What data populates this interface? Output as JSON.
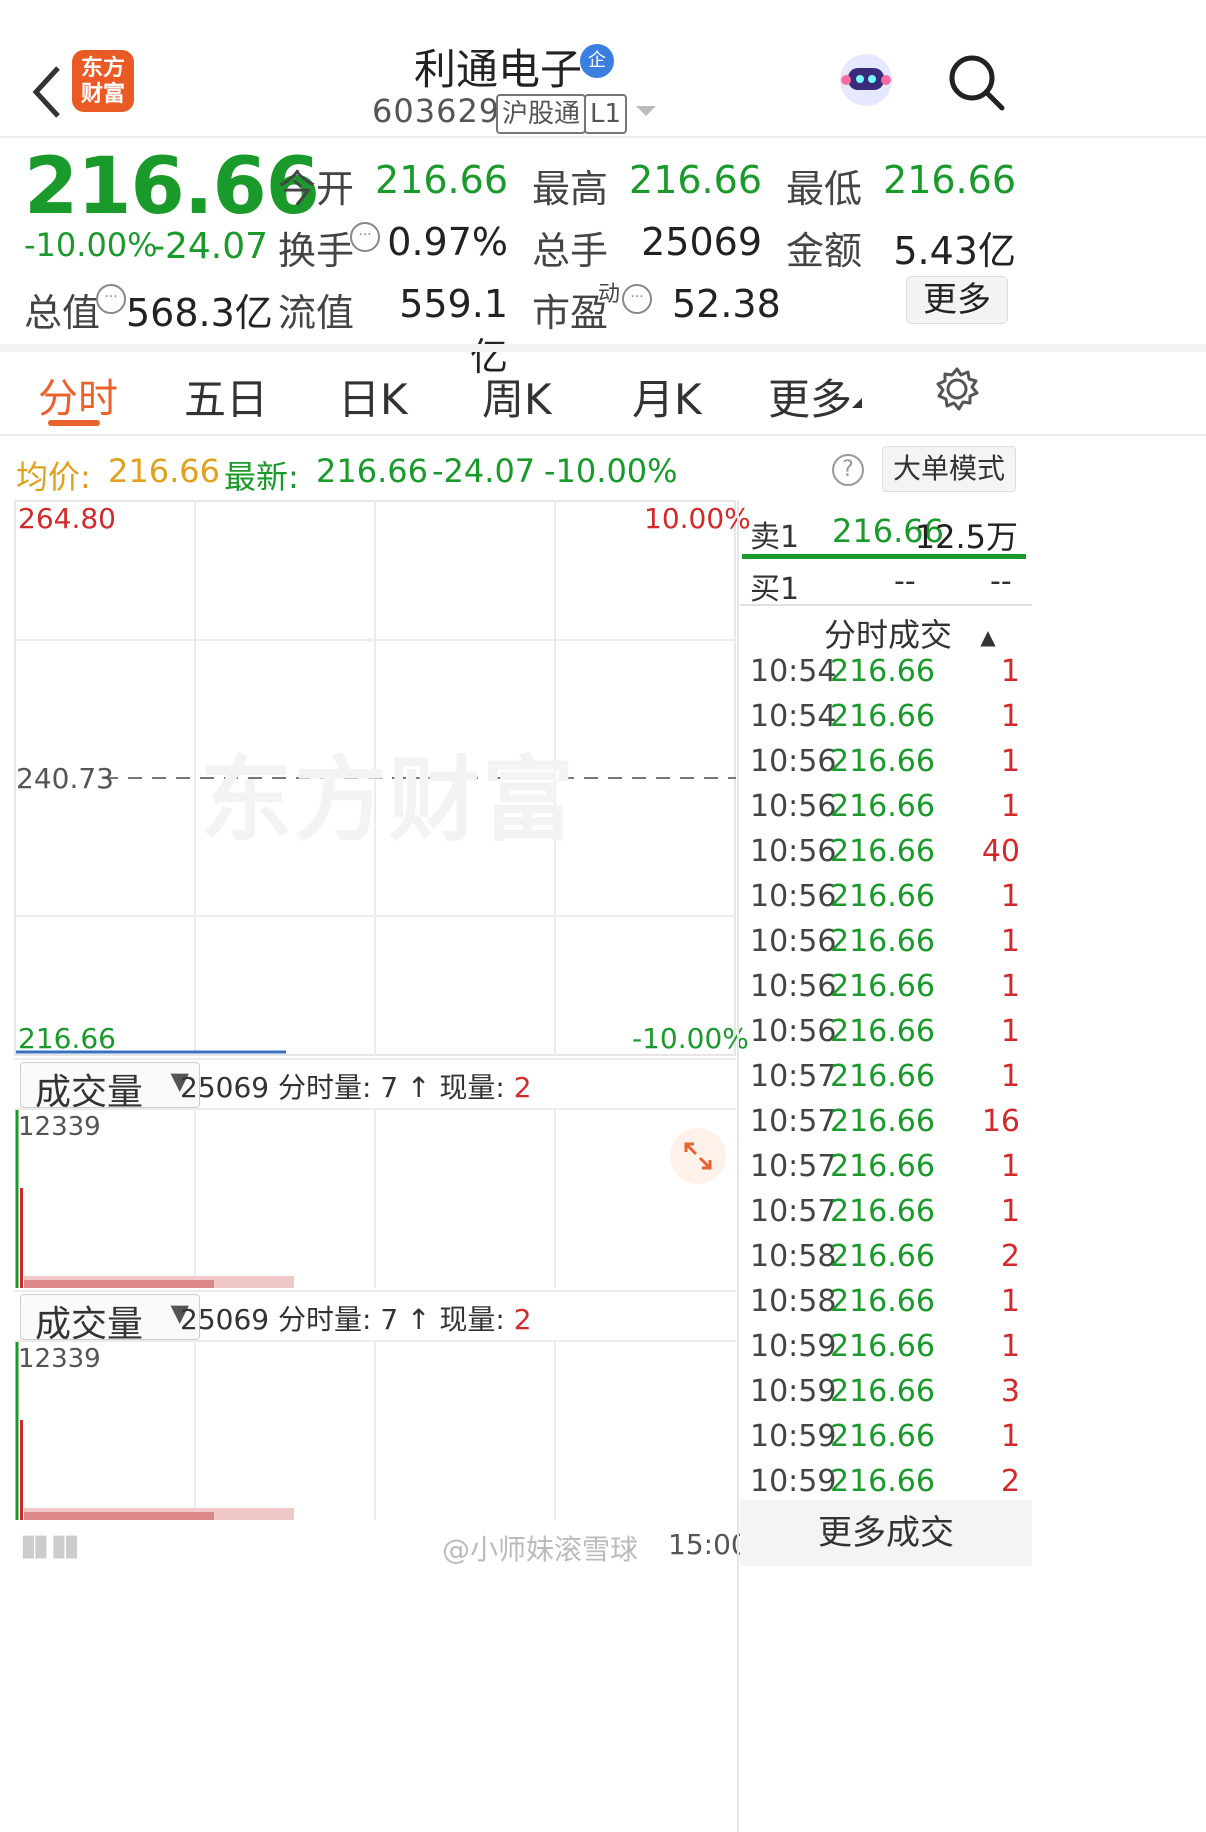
{
  "header": {
    "logo_text_line1": "东方",
    "logo_text_line2": "财富",
    "stock_name": "利通电子",
    "badge": "企",
    "stock_code": "603629",
    "tag_hgt": "沪股通",
    "tag_level": "L1"
  },
  "quote": {
    "price": "216.66",
    "change_pct": "-10.00%",
    "change_amt": "-24.07",
    "rows": [
      [
        {
          "label": "今开",
          "value": "216.66"
        },
        {
          "label": "最高",
          "value": "216.66"
        },
        {
          "label": "最低",
          "value": "216.66"
        }
      ],
      [
        {
          "label": "换手",
          "value": "0.97%"
        },
        {
          "label": "总手",
          "value": "25069"
        },
        {
          "label": "金额",
          "value": "5.43亿"
        }
      ]
    ],
    "total_value_label": "总值",
    "total_value": "568.3亿",
    "float_value_label": "流值",
    "float_value": "559.1亿",
    "pe_label": "市盈",
    "pe_sup": "动",
    "pe_value": "52.38",
    "more_button": "更多"
  },
  "tabs": [
    "分时",
    "五日",
    "日K",
    "周K",
    "月K",
    "更多"
  ],
  "active_tab": 0,
  "info_bar": {
    "avg_label": "均价:",
    "avg_value": "216.66",
    "latest_label": "最新:",
    "latest_value": "216.66",
    "latest_change": "-24.07",
    "latest_pct": "-10.00%",
    "help_icon": "?",
    "big_order_button": "大单模式"
  },
  "chart": {
    "y_top": "264.80",
    "y_mid": "240.73",
    "y_bottom": "216.66",
    "pct_top": "10.00%",
    "pct_bottom": "-10.00%",
    "watermark": "东方财富",
    "end_time": "15:00"
  },
  "volume_panels": [
    {
      "selector": "成交量",
      "total": "25069",
      "min_vol_label": "分时量: 7",
      "cur_label": "现量:",
      "cur_value": "2",
      "max_label": "12339"
    },
    {
      "selector": "成交量",
      "total": "25069",
      "min_vol_label": "分时量: 7",
      "cur_label": "现量:",
      "cur_value": "2",
      "max_label": "12339"
    }
  ],
  "order_book": {
    "sell1_label": "卖1",
    "sell1_price": "216.66",
    "sell1_vol": "12.5万",
    "buy1_label": "买1",
    "buy1_price": "--",
    "buy1_vol": "--"
  },
  "trades_header": "分时成交",
  "trades": [
    {
      "time": "10:54",
      "price": "216.66",
      "vol": "1"
    },
    {
      "time": "10:54",
      "price": "216.66",
      "vol": "1"
    },
    {
      "time": "10:56",
      "price": "216.66",
      "vol": "1"
    },
    {
      "time": "10:56",
      "price": "216.66",
      "vol": "1"
    },
    {
      "time": "10:56",
      "price": "216.66",
      "vol": "40"
    },
    {
      "time": "10:56",
      "price": "216.66",
      "vol": "1"
    },
    {
      "time": "10:56",
      "price": "216.66",
      "vol": "1"
    },
    {
      "time": "10:56",
      "price": "216.66",
      "vol": "1"
    },
    {
      "time": "10:56",
      "price": "216.66",
      "vol": "1"
    },
    {
      "time": "10:57",
      "price": "216.66",
      "vol": "1"
    },
    {
      "time": "10:57",
      "price": "216.66",
      "vol": "16"
    },
    {
      "time": "10:57",
      "price": "216.66",
      "vol": "1"
    },
    {
      "time": "10:57",
      "price": "216.66",
      "vol": "1"
    },
    {
      "time": "10:58",
      "price": "216.66",
      "vol": "2"
    },
    {
      "time": "10:58",
      "price": "216.66",
      "vol": "1"
    },
    {
      "time": "10:59",
      "price": "216.66",
      "vol": "1"
    },
    {
      "time": "10:59",
      "price": "216.66",
      "vol": "3"
    },
    {
      "time": "10:59",
      "price": "216.66",
      "vol": "1"
    },
    {
      "time": "10:59",
      "price": "216.66",
      "vol": "2"
    }
  ],
  "more_trades_button": "更多成交",
  "footer_watermark": "@小师妹滚雪球",
  "colors": {
    "down": "#1a9a2a",
    "up": "#d22a2a",
    "accent": "#e8642c",
    "avg": "#e0a020"
  }
}
